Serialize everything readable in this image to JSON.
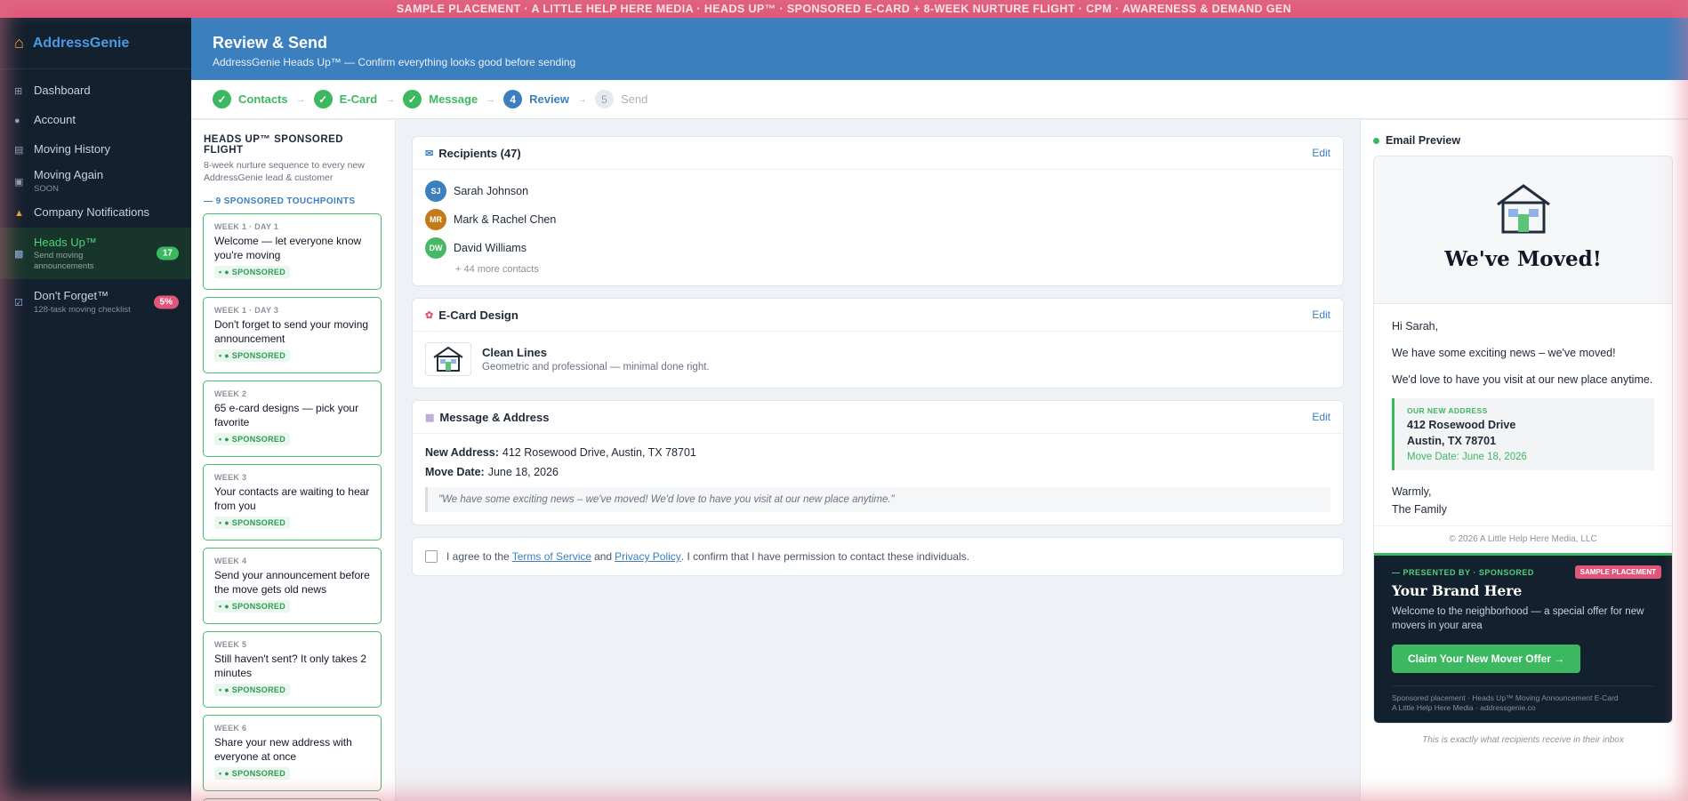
{
  "banner": {
    "text": "SAMPLE PLACEMENT  ·  A LITTLE HELP HERE MEDIA  ·  HEADS UP™  ·  SPONSORED E-CARD + 8-WEEK NURTURE FLIGHT  ·  CPM · AWARENESS & DEMAND GEN"
  },
  "brand": {
    "name": "AddressGenie"
  },
  "sidebar": {
    "items": [
      {
        "label": "Dashboard",
        "sub": "",
        "badge": ""
      },
      {
        "label": "Account",
        "sub": "",
        "badge": ""
      },
      {
        "label": "Moving History",
        "sub": "",
        "badge": ""
      },
      {
        "label": "Moving Again",
        "sub": "SOON",
        "badge": ""
      },
      {
        "label": "Company Notifications",
        "sub": "",
        "badge": ""
      },
      {
        "label": "Heads Up™",
        "sub": "Send moving announcements",
        "badge": "17"
      },
      {
        "label": "Don't Forget™",
        "sub": "128-task moving checklist",
        "badge": "5%"
      }
    ]
  },
  "header": {
    "title": "Review & Send",
    "subtitle": "AddressGenie Heads Up™ — Confirm everything looks good before sending"
  },
  "steps": [
    {
      "num": "✓",
      "label": "Contacts"
    },
    {
      "num": "✓",
      "label": "E-Card"
    },
    {
      "num": "✓",
      "label": "Message"
    },
    {
      "num": "4",
      "label": "Review"
    },
    {
      "num": "5",
      "label": "Send"
    }
  ],
  "flight": {
    "title": "HEADS UP™ SPONSORED FLIGHT",
    "desc": "8-week nurture sequence to every new AddressGenie lead & customer",
    "touchpoints": "— 9 SPONSORED TOUCHPOINTS",
    "cards": [
      {
        "week": "WEEK 1 · DAY 1",
        "title": "Welcome — let everyone know you're moving",
        "tag": "• ● SPONSORED"
      },
      {
        "week": "WEEK 1 · DAY 3",
        "title": "Don't forget to send your moving announcement",
        "tag": "• ● SPONSORED"
      },
      {
        "week": "WEEK 2",
        "title": "65 e-card designs — pick your favorite",
        "tag": "• ● SPONSORED"
      },
      {
        "week": "WEEK 3",
        "title": "Your contacts are waiting to hear from you",
        "tag": "• ● SPONSORED"
      },
      {
        "week": "WEEK 4",
        "title": "Send your announcement before the move gets old news",
        "tag": "• ● SPONSORED"
      },
      {
        "week": "WEEK 5",
        "title": "Still haven't sent? It only takes 2 minutes",
        "tag": "• ● SPONSORED"
      },
      {
        "week": "WEEK 6",
        "title": "Share your new address with everyone at once",
        "tag": "• ● SPONSORED"
      }
    ]
  },
  "recipients": {
    "title": "Recipients (47)",
    "edit": "Edit",
    "list": [
      {
        "initials": "SJ",
        "name": "Sarah Johnson",
        "color": "#3b7fbf"
      },
      {
        "initials": "MR",
        "name": "Mark & Rachel Chen",
        "color": "#c27a1a"
      },
      {
        "initials": "DW",
        "name": "David Williams",
        "color": "#47b866"
      }
    ],
    "more": "+ 44 more contacts"
  },
  "ecard": {
    "title": "E-Card Design",
    "edit": "Edit",
    "name": "Clean Lines",
    "desc": "Geometric and professional — minimal done right."
  },
  "message": {
    "title": "Message & Address",
    "edit": "Edit",
    "address_label": "New Address:",
    "address": "412 Rosewood Drive, Austin, TX 78701",
    "date_label": "Move Date:",
    "date": "June 18, 2026",
    "quote": "\"We have some exciting news – we've moved! We'd love to have you visit at our new place anytime.\""
  },
  "agree": {
    "pre": "I agree to the",
    "terms": "Terms of Service",
    "and": "and",
    "privacy": "Privacy Policy",
    "post": ". I confirm that I have permission to contact these individuals."
  },
  "preview": {
    "title": "Email Preview",
    "headline": "We've Moved!",
    "greeting": "Hi Sarah,",
    "p1": "We have some exciting news – we've moved!",
    "p2": "We'd love to have you visit at our new place anytime.",
    "addr_label": "OUR NEW ADDRESS",
    "addr1": "412 Rosewood Drive",
    "addr2": "Austin, TX 78701",
    "move_date": "Move Date: June 18, 2026",
    "sign1": "Warmly,",
    "sign2": "The Family",
    "footer": "© 2026 A Little Help Here Media, LLC",
    "caption": "This is exactly what recipients receive in their inbox"
  },
  "ad": {
    "presented": "— PRESENTED BY · SPONSORED",
    "sample": "SAMPLE PLACEMENT",
    "headline": "Your Brand Here",
    "text": "Welcome to the neighborhood — a special offer for new movers in your area",
    "cta": "Claim Your New Mover Offer →",
    "fine1": "Sponsored placement · Heads Up™ Moving Announcement E-Card",
    "fine2": "A Little Help Here Media · addressgenie.co"
  },
  "colors": {
    "accent": "#3b7fbf",
    "success": "#3cb861",
    "banner": "#e0567a",
    "sidebar": "#13202e"
  }
}
